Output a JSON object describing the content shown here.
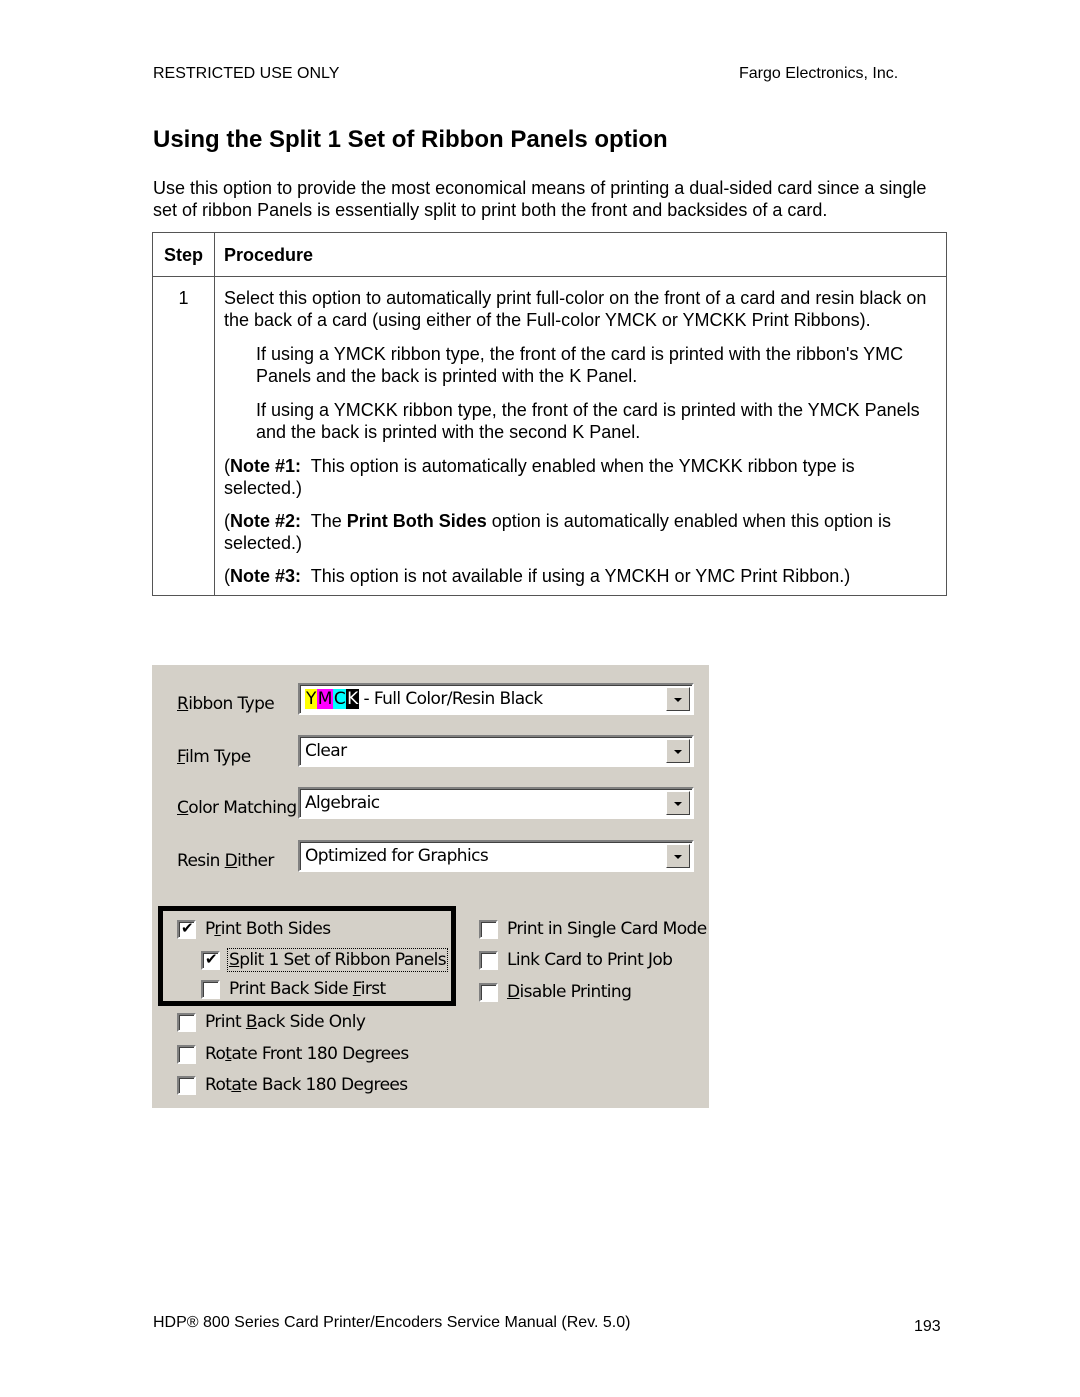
{
  "header": {
    "left": "RESTRICTED USE ONLY",
    "right": "Fargo Electronics, Inc."
  },
  "title": "Using the Split 1 Set of Ribbon Panels option",
  "intro": "Use this option to provide the most economical means of printing a dual-sided card since a single set of ribbon Panels is essentially split to print both the front and backsides of a card.",
  "table": {
    "headers": [
      "Step",
      "Procedure"
    ],
    "rows": [
      {
        "step": "1",
        "main": "Select this option to automatically print full-color on the front of a card and resin black on the back of a card (using either of the Full-color YMCK or YMCKK Print Ribbons).",
        "indented": [
          "If using a YMCK ribbon type, the front of the card is printed with the ribbon's YMC Panels and the back is printed with the K Panel.",
          "If using a YMCKK ribbon type, the front of the card is printed with the YMCK Panels and the back is printed with the second K Panel."
        ],
        "notes": [
          {
            "label": "Note #1:",
            "pre": "This option is automatically enabled when the YMCKK ribbon type is selected.",
            "bold": "",
            "post": ""
          },
          {
            "label": "Note #2:",
            "pre": "The ",
            "bold": "Print Both Sides",
            "post": " option is automatically enabled when this option is selected."
          },
          {
            "label": "Note #3:",
            "pre": "This option is not available if using a YMCKH or YMC Print Ribbon.",
            "bold": "",
            "post": ""
          }
        ]
      }
    ]
  },
  "dialog": {
    "fields": [
      {
        "label_pre": "",
        "label_key": "R",
        "label_post": "ibbon Type",
        "value": "- Full Color/Resin Black",
        "swatches": [
          "Y",
          "M",
          "C",
          "K"
        ]
      },
      {
        "label_pre": "",
        "label_key": "F",
        "label_post": "ilm Type",
        "value": "Clear"
      },
      {
        "label_pre": "",
        "label_key": "C",
        "label_post": "olor Matching",
        "value": "Algebraic"
      },
      {
        "label_pre": "Resin ",
        "label_key": "D",
        "label_post": "ither",
        "value": "Optimized for Graphics"
      }
    ],
    "swatch_colors": {
      "Y": "#ffff00",
      "M": "#ff00ff",
      "C": "#00ffff",
      "K": "#000000"
    },
    "checkboxes_left": [
      {
        "pre": "P",
        "key": "r",
        "post": "int Both Sides",
        "checked": true
      },
      {
        "pre": "",
        "key": "S",
        "post": "plit 1 Set of Ribbon Panels",
        "checked": true
      },
      {
        "pre": "Print Back Side ",
        "key": "F",
        "post": "irst",
        "checked": false
      },
      {
        "pre": "Print ",
        "key": "B",
        "post": "ack Side Only",
        "checked": false
      },
      {
        "pre": "Ro",
        "key": "t",
        "post": "ate Front 180 Degrees",
        "checked": false
      },
      {
        "pre": "Rot",
        "key": "a",
        "post": "te Back 180 Degrees",
        "checked": false
      }
    ],
    "checkboxes_right": [
      {
        "pre": "Print in Single Card Mode",
        "key": "",
        "post": "",
        "checked": false
      },
      {
        "pre": "Link Card to Print Job",
        "key": "",
        "post": "",
        "checked": false
      },
      {
        "pre": "",
        "key": "D",
        "post": "isable Printing",
        "checked": false
      }
    ],
    "check_mark": "✔"
  },
  "footer": {
    "left": "HDP® 800 Series Card Printer/Encoders Service Manual (Rev. 5.0)",
    "page": "193"
  }
}
